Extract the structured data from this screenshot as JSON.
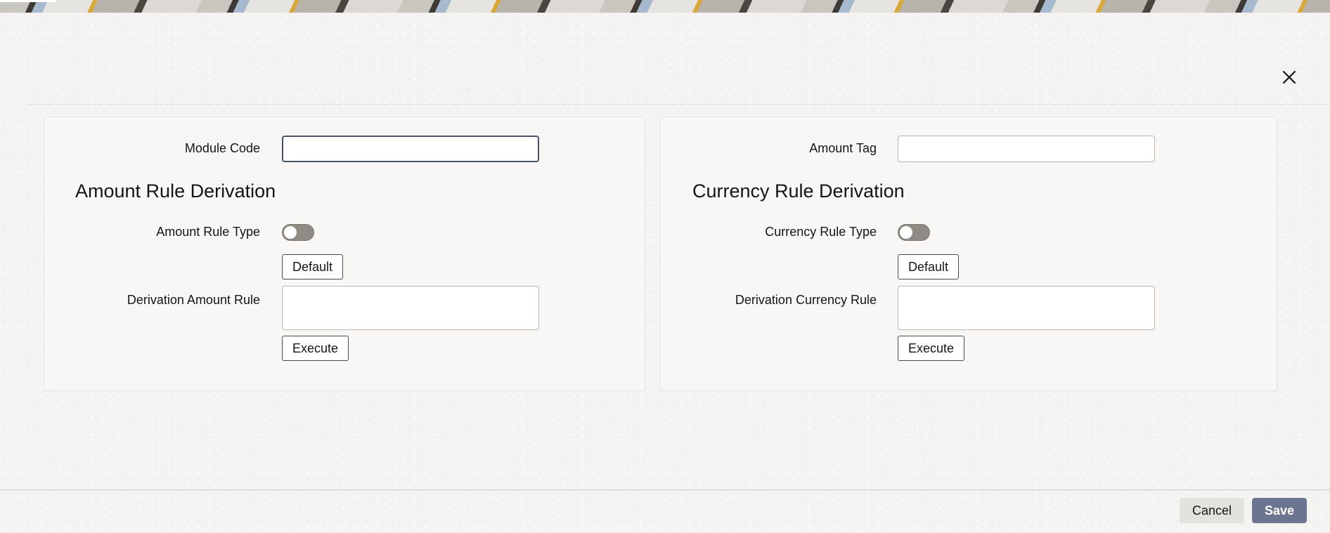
{
  "header": {
    "close_icon": "close-icon"
  },
  "left_panel": {
    "module_code_label": "Module Code",
    "module_code_value": "",
    "section_title": "Amount Rule Derivation",
    "rule_type_label": "Amount Rule Type",
    "rule_type_on": false,
    "default_button": "Default",
    "derivation_rule_label": "Derivation Amount Rule",
    "derivation_rule_value": "",
    "execute_button": "Execute"
  },
  "right_panel": {
    "amount_tag_label": "Amount Tag",
    "amount_tag_value": "",
    "section_title": "Currency Rule Derivation",
    "rule_type_label": "Currency Rule Type",
    "rule_type_on": false,
    "default_button": "Default",
    "derivation_rule_label": "Derivation Currency Rule",
    "derivation_rule_value": "",
    "execute_button": "Execute"
  },
  "footer": {
    "cancel_label": "Cancel",
    "save_label": "Save"
  },
  "colors": {
    "primary_button": "#6c7590",
    "toggle_off": "#8f8a84",
    "focus_border": "#4a5368"
  }
}
